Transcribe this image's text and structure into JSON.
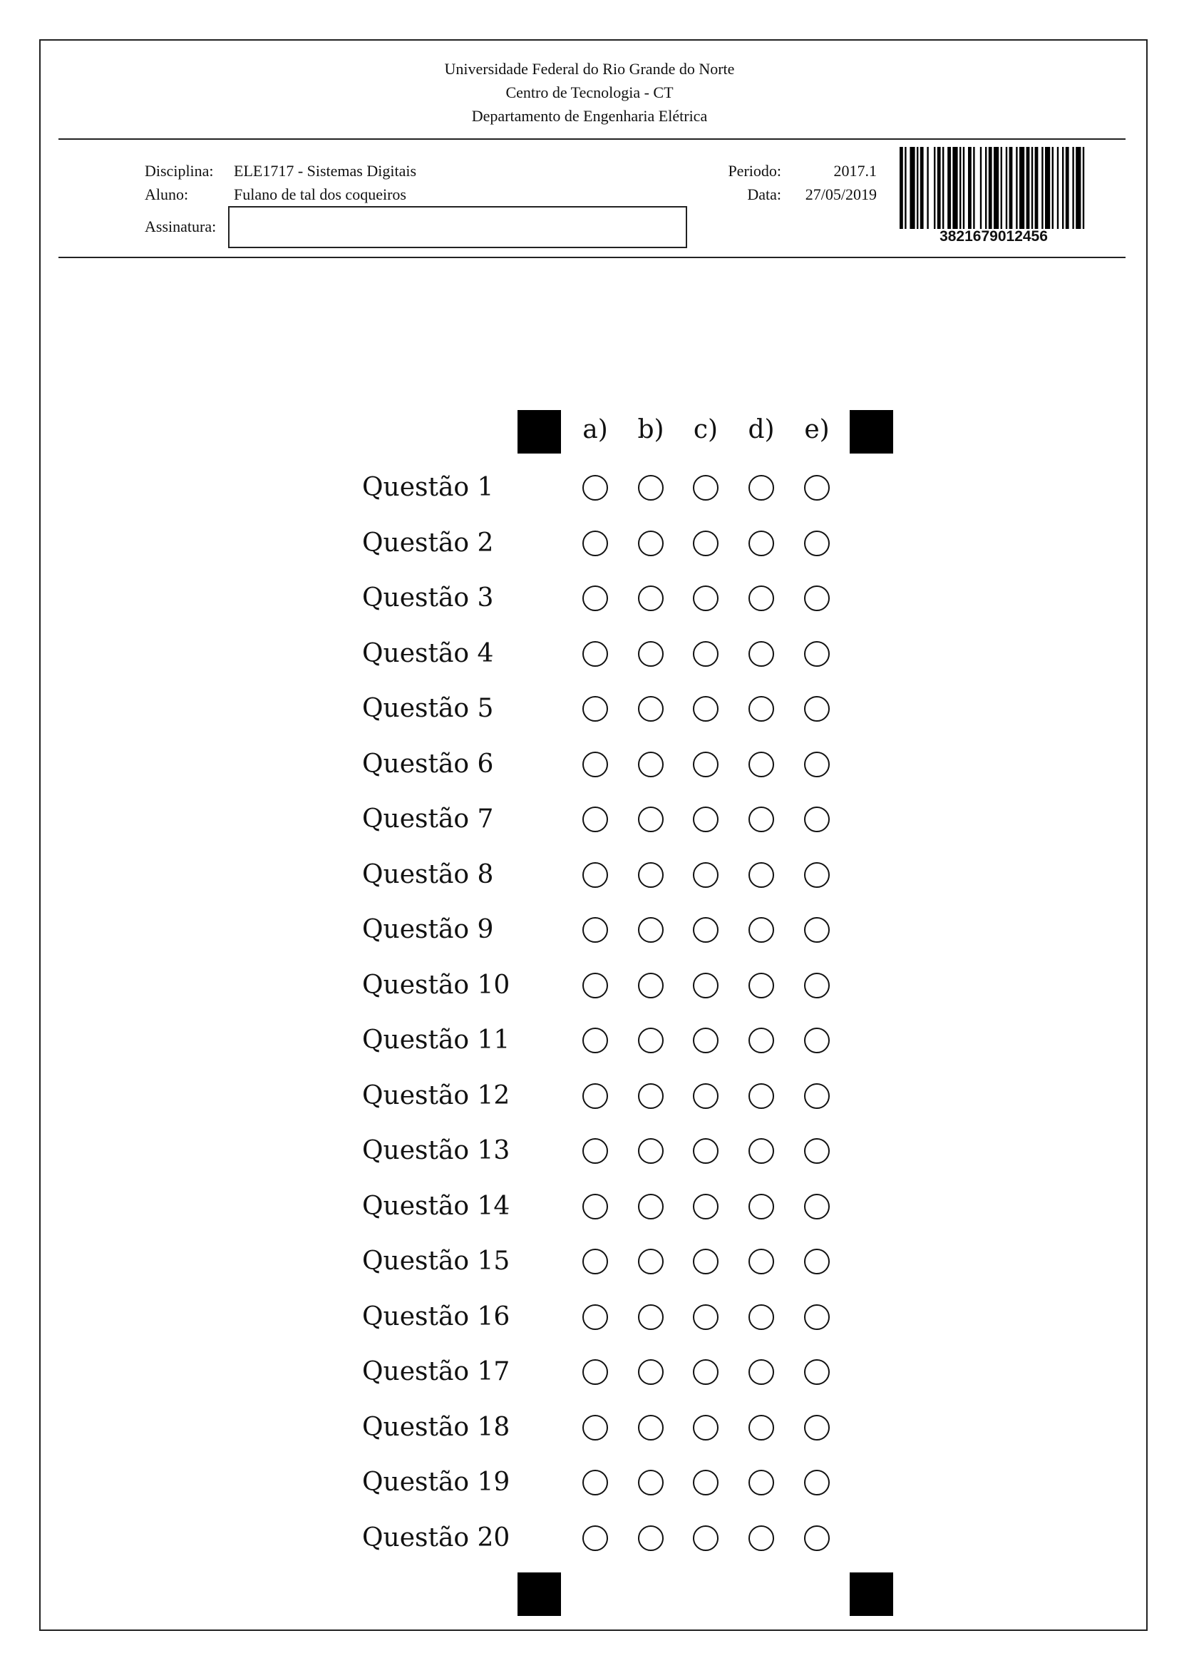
{
  "header": {
    "university": "Universidade Federal do Rio Grande do Norte",
    "center": "Centro de Tecnologia - CT",
    "department": "Departamento de Engenharia Elétrica"
  },
  "info": {
    "disciplina_label": "Disciplina:",
    "disciplina_value": "ELE1717 - Sistemas Digitais",
    "aluno_label": "Aluno:",
    "aluno_value": "Fulano de tal dos coqueiros",
    "assinatura_label": "Assinatura:",
    "periodo_label": "Periodo:",
    "periodo_value": "2017.1",
    "data_label": "Data:",
    "data_value": "27/05/2019"
  },
  "barcode": {
    "number": "3821679012456"
  },
  "options": [
    "a)",
    "b)",
    "c)",
    "d)",
    "e)"
  ],
  "questions": [
    "Questão 1",
    "Questão 2",
    "Questão 3",
    "Questão 4",
    "Questão 5",
    "Questão 6",
    "Questão 7",
    "Questão 8",
    "Questão 9",
    "Questão 10",
    "Questão 11",
    "Questão 12",
    "Questão 13",
    "Questão 14",
    "Questão 15",
    "Questão 16",
    "Questão 17",
    "Questão 18",
    "Questão 19",
    "Questão 20"
  ]
}
